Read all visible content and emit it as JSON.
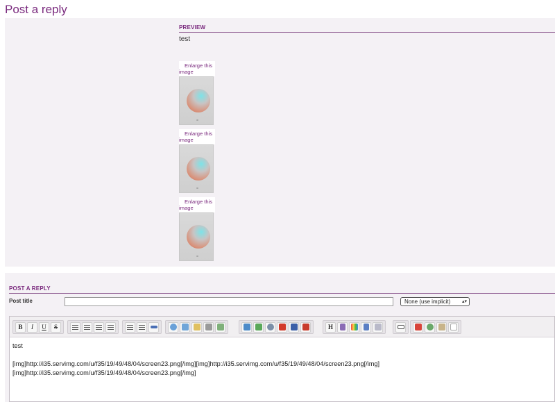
{
  "page": {
    "title": "Post a reply"
  },
  "preview": {
    "heading": "PREVIEW",
    "text": "test",
    "images": [
      {
        "enlarge_label": "Enlarge this image"
      },
      {
        "enlarge_label": "Enlarge this image"
      },
      {
        "enlarge_label": "Enlarge this image"
      }
    ]
  },
  "reply": {
    "heading": "POST A REPLY",
    "title_label": "Post title",
    "title_value": "",
    "icon_select": "None (use implicit)",
    "editor": {
      "content": "test\n\n[img]http://i35.servimg.com/u/f35/19/49/48/04/screen23.png[/img][img]http://i35.servimg.com/u/f35/19/49/48/04/screen23.png[/img]\n[img]http://i35.servimg.com/u/f35/19/49/48/04/screen23.png[/img]"
    },
    "toolbar": {
      "bold": "B",
      "italic": "I",
      "underline": "U",
      "strike": "S",
      "heading": "H"
    }
  },
  "colors": {
    "accent": "#7a2a7e",
    "panel": "#f4f1f5"
  }
}
